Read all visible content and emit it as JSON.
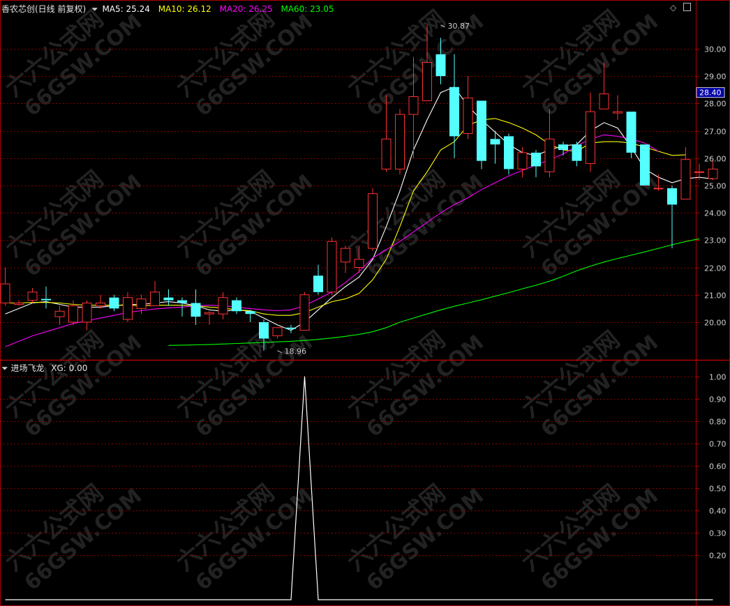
{
  "header": {
    "stock_title": "香农芯创(日线 前复权)",
    "ma": [
      {
        "label": "MA5: 25.24",
        "color": "#ffffff"
      },
      {
        "label": "MA10: 26.12",
        "color": "#ffff00"
      },
      {
        "label": "MA20: 26.25",
        "color": "#ff00ff"
      },
      {
        "label": "MA60: 23.05",
        "color": "#00ff00"
      }
    ]
  },
  "indicator": {
    "title": "进场飞龙",
    "value_label": "XG: 0.00"
  },
  "watermark": {
    "text": "六六公式网",
    "url": "66GSW.COM"
  },
  "current_price_tag": "28.40",
  "colors": {
    "up": "#ff3232",
    "down": "#54ffff",
    "ma5": "#ffffff",
    "ma10": "#ffff00",
    "ma20": "#ff00ff",
    "ma60": "#00ff00",
    "grid": "#8b0000",
    "axis_text": "#cfcfcf",
    "frame": "#b00000"
  },
  "chart_data": [
    {
      "type": "candlestick",
      "title": "香农芯创(日线 前复权)",
      "ylim": [
        18.8,
        31.3
      ],
      "yticks": [
        20,
        21,
        22,
        23,
        24,
        25,
        26,
        27,
        28,
        29,
        30
      ],
      "ytick_labels": [
        "20.00",
        "21.00",
        "22.00",
        "23.00",
        "24.00",
        "25.00",
        "26.00",
        "27.00",
        "28.00",
        "29.00",
        "30.00"
      ],
      "annotations": [
        {
          "text": "30.87",
          "price": 30.87,
          "bar": 32
        },
        {
          "text": "18.96",
          "price": 18.96,
          "bar": 20
        }
      ],
      "candles": [
        {
          "o": 20.7,
          "c": 21.4,
          "h": 22.0,
          "l": 20.6
        },
        {
          "o": 20.65,
          "c": 20.7,
          "h": 20.8,
          "l": 20.6
        },
        {
          "o": 20.8,
          "c": 21.1,
          "h": 21.25,
          "l": 20.7
        },
        {
          "o": 20.85,
          "c": 20.8,
          "h": 21.3,
          "l": 20.5
        },
        {
          "o": 20.2,
          "c": 20.4,
          "h": 20.6,
          "l": 19.9
        },
        {
          "o": 20.0,
          "c": 20.6,
          "h": 20.8,
          "l": 19.9
        },
        {
          "o": 20.0,
          "c": 20.7,
          "h": 20.8,
          "l": 19.7
        },
        {
          "o": 20.6,
          "c": 20.7,
          "h": 21.0,
          "l": 20.5
        },
        {
          "o": 20.9,
          "c": 20.5,
          "h": 21.0,
          "l": 20.4
        },
        {
          "o": 20.1,
          "c": 20.9,
          "h": 21.1,
          "l": 20.0
        },
        {
          "o": 20.5,
          "c": 20.85,
          "h": 21.0,
          "l": 20.3
        },
        {
          "o": 20.6,
          "c": 21.1,
          "h": 21.5,
          "l": 20.6
        },
        {
          "o": 20.9,
          "c": 20.8,
          "h": 21.2,
          "l": 20.6
        },
        {
          "o": 20.8,
          "c": 20.7,
          "h": 20.9,
          "l": 20.2
        },
        {
          "o": 20.7,
          "c": 20.2,
          "h": 21.2,
          "l": 19.9
        },
        {
          "o": 20.3,
          "c": 20.35,
          "h": 20.4,
          "l": 19.9
        },
        {
          "o": 20.3,
          "c": 20.9,
          "h": 21.1,
          "l": 20.1
        },
        {
          "o": 20.8,
          "c": 20.4,
          "h": 20.9,
          "l": 20.3
        },
        {
          "o": 20.4,
          "c": 20.3,
          "h": 20.45,
          "l": 20.0
        },
        {
          "o": 20.0,
          "c": 19.4,
          "h": 20.1,
          "l": 18.96
        },
        {
          "o": 19.5,
          "c": 19.8,
          "h": 19.8,
          "l": 19.4
        },
        {
          "o": 19.8,
          "c": 19.75,
          "h": 19.9,
          "l": 19.6
        },
        {
          "o": 19.7,
          "c": 21.0,
          "h": 21.1,
          "l": 19.7
        },
        {
          "o": 21.7,
          "c": 21.1,
          "h": 22.1,
          "l": 21.0
        },
        {
          "o": 21.1,
          "c": 22.95,
          "h": 23.1,
          "l": 21.0
        },
        {
          "o": 22.2,
          "c": 22.7,
          "h": 22.8,
          "l": 21.8
        },
        {
          "o": 22.0,
          "c": 22.3,
          "h": 22.8,
          "l": 21.8
        },
        {
          "o": 22.7,
          "c": 24.7,
          "h": 24.9,
          "l": 22.6
        },
        {
          "o": 25.6,
          "c": 26.7,
          "h": 28.3,
          "l": 25.5
        },
        {
          "o": 25.6,
          "c": 27.6,
          "h": 27.8,
          "l": 25.4
        },
        {
          "o": 27.6,
          "c": 28.25,
          "h": 29.7,
          "l": 26.0
        },
        {
          "o": 28.1,
          "c": 29.5,
          "h": 30.87,
          "l": 28.1
        },
        {
          "o": 29.8,
          "c": 29.0,
          "h": 30.4,
          "l": 28.7
        },
        {
          "o": 28.6,
          "c": 26.8,
          "h": 29.8,
          "l": 26.0
        },
        {
          "o": 26.9,
          "c": 28.2,
          "h": 29.0,
          "l": 26.7
        },
        {
          "o": 28.1,
          "c": 25.9,
          "h": 28.1,
          "l": 25.6
        },
        {
          "o": 26.7,
          "c": 26.5,
          "h": 27.0,
          "l": 25.8
        },
        {
          "o": 26.8,
          "c": 25.6,
          "h": 26.9,
          "l": 25.4
        },
        {
          "o": 25.6,
          "c": 26.2,
          "h": 26.4,
          "l": 25.3
        },
        {
          "o": 26.2,
          "c": 25.7,
          "h": 26.3,
          "l": 25.3
        },
        {
          "o": 25.5,
          "c": 26.7,
          "h": 27.8,
          "l": 25.3
        },
        {
          "o": 26.5,
          "c": 26.3,
          "h": 26.6,
          "l": 26.1
        },
        {
          "o": 26.5,
          "c": 25.9,
          "h": 26.6,
          "l": 25.7
        },
        {
          "o": 25.8,
          "c": 27.7,
          "h": 28.4,
          "l": 25.5
        },
        {
          "o": 27.8,
          "c": 28.35,
          "h": 29.5,
          "l": 27.8
        },
        {
          "o": 27.65,
          "c": 27.7,
          "h": 28.3,
          "l": 27.4
        },
        {
          "o": 27.7,
          "c": 26.2,
          "h": 27.7,
          "l": 26.0
        },
        {
          "o": 26.5,
          "c": 25.0,
          "h": 26.5,
          "l": 25.0
        },
        {
          "o": 24.9,
          "c": 24.9,
          "h": 25.4,
          "l": 24.8
        },
        {
          "o": 24.9,
          "c": 24.3,
          "h": 25.0,
          "l": 22.7
        },
        {
          "o": 24.5,
          "c": 25.95,
          "h": 26.4,
          "l": 24.5
        },
        {
          "o": 25.5,
          "c": 25.5,
          "h": 25.8,
          "l": 25.2
        },
        {
          "o": 25.25,
          "c": 25.6,
          "h": 25.9,
          "l": 25.2
        }
      ],
      "series": [
        {
          "name": "MA5",
          "start": 0,
          "values": [
            20.3,
            20.5,
            20.7,
            20.75,
            20.65,
            20.55,
            20.55,
            20.55,
            20.6,
            20.65,
            20.65,
            20.7,
            20.75,
            20.7,
            20.6,
            20.45,
            20.4,
            20.45,
            20.4,
            20.15,
            19.9,
            19.7,
            20.0,
            20.45,
            20.9,
            21.3,
            21.65,
            22.3,
            23.5,
            24.8,
            26.3,
            27.4,
            28.4,
            28.6,
            27.9,
            27.4,
            26.95,
            26.5,
            26.2,
            26.1,
            26.3,
            26.45,
            26.5,
            27.0,
            27.3,
            27.1,
            26.4,
            25.6,
            25.3,
            25.1,
            25.25,
            25.3,
            25.24
          ]
        },
        {
          "name": "MA10",
          "start": 0,
          "values": [
            20.7,
            20.7,
            20.72,
            20.72,
            20.7,
            20.65,
            20.62,
            20.62,
            20.62,
            20.62,
            20.6,
            20.62,
            20.62,
            20.62,
            20.6,
            20.55,
            20.52,
            20.45,
            20.42,
            20.3,
            20.25,
            20.25,
            20.35,
            20.55,
            20.75,
            20.85,
            21.05,
            21.55,
            22.3,
            23.5,
            24.8,
            25.5,
            26.3,
            26.6,
            27.2,
            27.4,
            27.45,
            27.3,
            27.1,
            26.85,
            26.5,
            26.3,
            26.25,
            26.55,
            26.6,
            26.6,
            26.55,
            26.4,
            26.25,
            26.1,
            26.12
          ]
        },
        {
          "name": "MA20",
          "start": 0,
          "values": [
            19.1,
            19.3,
            19.5,
            19.65,
            19.8,
            19.95,
            20.05,
            20.15,
            20.25,
            20.35,
            20.42,
            20.48,
            20.52,
            20.55,
            20.6,
            20.62,
            20.6,
            20.55,
            20.5,
            20.45,
            20.42,
            20.45,
            20.6,
            20.85,
            21.1,
            21.45,
            21.85,
            22.35,
            22.65,
            22.95,
            23.3,
            23.65,
            24.0,
            24.3,
            24.55,
            24.85,
            25.1,
            25.35,
            25.55,
            25.75,
            25.95,
            26.15,
            26.45,
            26.7,
            26.85,
            26.8,
            26.7,
            26.55,
            26.25
          ]
        },
        {
          "name": "MA60",
          "start": 12,
          "values": [
            19.15,
            19.16,
            19.17,
            19.18,
            19.2,
            19.22,
            19.24,
            19.26,
            19.28,
            19.3,
            19.33,
            19.37,
            19.42,
            19.48,
            19.55,
            19.65,
            19.8,
            20.0,
            20.15,
            20.3,
            20.45,
            20.58,
            20.7,
            20.82,
            20.95,
            21.08,
            21.22,
            21.35,
            21.5,
            21.68,
            21.88,
            22.05,
            22.2,
            22.33,
            22.45,
            22.57,
            22.7,
            22.83,
            22.95,
            23.05
          ]
        }
      ]
    },
    {
      "type": "line",
      "title": "进场飞龙",
      "ylim": [
        0,
        1.03
      ],
      "yticks": [
        0.2,
        0.3,
        0.4,
        0.5,
        0.6,
        0.7,
        0.8,
        0.9,
        1.0
      ],
      "ytick_labels": [
        "0.20",
        "0.30",
        "0.40",
        "0.50",
        "0.60",
        "0.70",
        "0.80",
        "0.90",
        "1.00"
      ],
      "series": [
        {
          "name": "XG",
          "spike_bar": 22,
          "values": [
            0,
            0,
            0,
            0,
            0,
            0,
            0,
            0,
            0,
            0,
            0,
            0,
            0,
            0,
            0,
            0,
            0,
            0,
            0,
            0,
            0,
            0,
            1,
            0,
            0,
            0,
            0,
            0,
            0,
            0,
            0,
            0,
            0,
            0,
            0,
            0,
            0,
            0,
            0,
            0,
            0,
            0,
            0,
            0,
            0,
            0,
            0,
            0,
            0,
            0,
            0,
            0,
            0
          ]
        }
      ]
    }
  ]
}
